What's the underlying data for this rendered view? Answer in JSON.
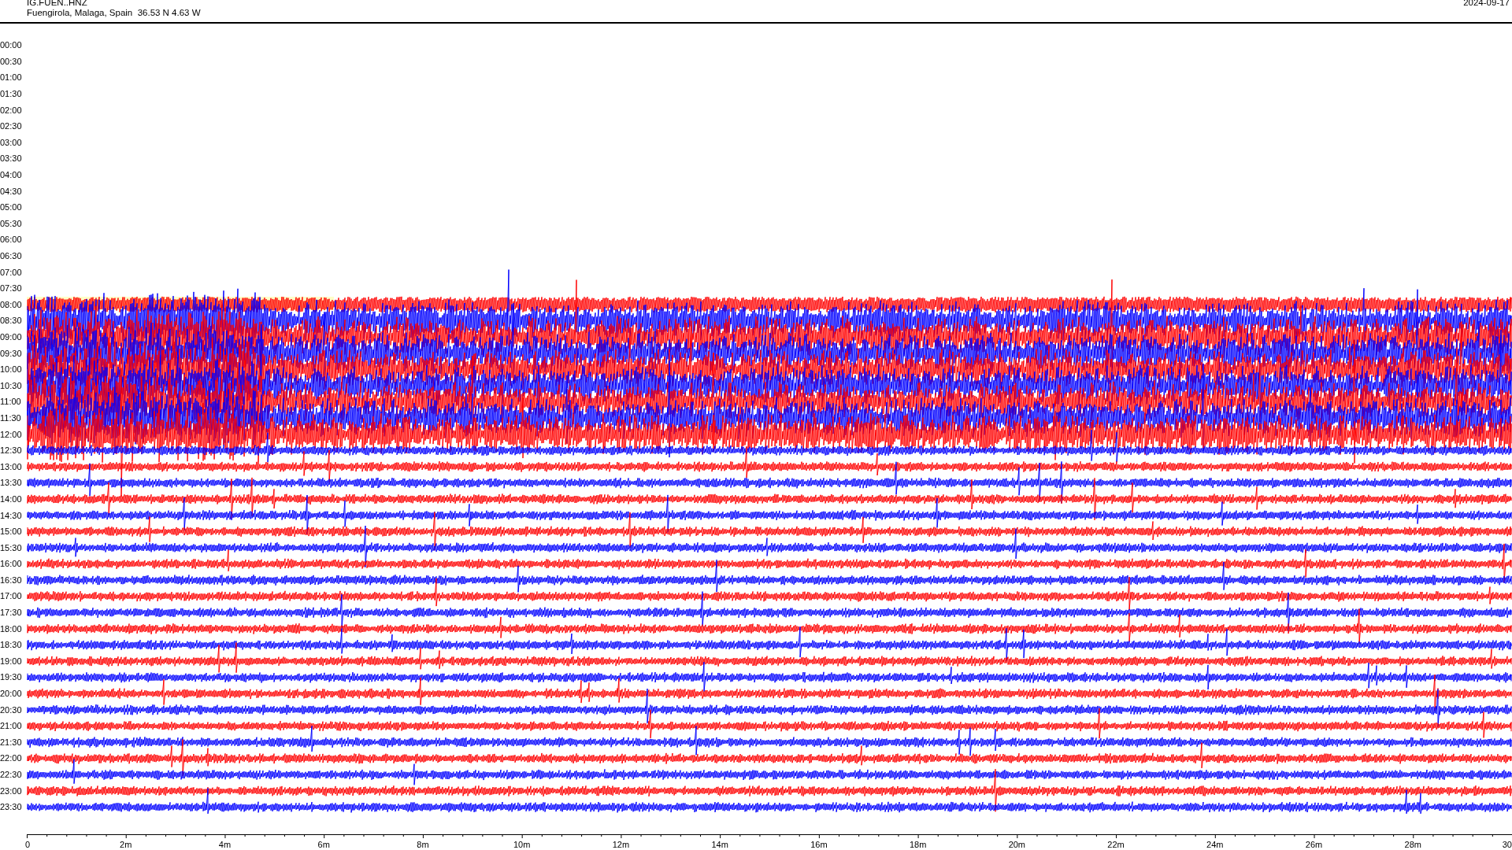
{
  "header": {
    "station": "IG.FUEN..HNZ",
    "location": "Fuengirola, Malaga, Spain  36.53 N 4.63 W",
    "date": "2024-09-17"
  },
  "rows": [
    {
      "time": "00:00",
      "trace": false
    },
    {
      "time": "00:30",
      "trace": false
    },
    {
      "time": "01:00",
      "trace": false
    },
    {
      "time": "01:30",
      "trace": false
    },
    {
      "time": "02:00",
      "trace": false
    },
    {
      "time": "02:30",
      "trace": false
    },
    {
      "time": "03:00",
      "trace": false
    },
    {
      "time": "03:30",
      "trace": false
    },
    {
      "time": "04:00",
      "trace": false
    },
    {
      "time": "04:30",
      "trace": false
    },
    {
      "time": "05:00",
      "trace": false
    },
    {
      "time": "05:30",
      "trace": false
    },
    {
      "time": "06:00",
      "trace": false
    },
    {
      "time": "06:30",
      "trace": false
    },
    {
      "time": "07:00",
      "trace": false
    },
    {
      "time": "07:30",
      "trace": false
    },
    {
      "time": "08:00",
      "trace": true
    },
    {
      "time": "08:30",
      "trace": true
    },
    {
      "time": "09:00",
      "trace": true
    },
    {
      "time": "09:30",
      "trace": true
    },
    {
      "time": "10:00",
      "trace": true
    },
    {
      "time": "10:30",
      "trace": true
    },
    {
      "time": "11:00",
      "trace": true
    },
    {
      "time": "11:30",
      "trace": true
    },
    {
      "time": "12:00",
      "trace": true
    },
    {
      "time": "12:30",
      "trace": true
    },
    {
      "time": "13:00",
      "trace": true
    },
    {
      "time": "13:30",
      "trace": true
    },
    {
      "time": "14:00",
      "trace": true
    },
    {
      "time": "14:30",
      "trace": true
    },
    {
      "time": "15:00",
      "trace": true
    },
    {
      "time": "15:30",
      "trace": true
    },
    {
      "time": "16:00",
      "trace": true
    },
    {
      "time": "16:30",
      "trace": true
    },
    {
      "time": "17:00",
      "trace": true
    },
    {
      "time": "17:30",
      "trace": true
    },
    {
      "time": "18:00",
      "trace": true
    },
    {
      "time": "18:30",
      "trace": true
    },
    {
      "time": "19:00",
      "trace": true
    },
    {
      "time": "19:30",
      "trace": true
    },
    {
      "time": "20:00",
      "trace": true
    },
    {
      "time": "20:30",
      "trace": true
    },
    {
      "time": "21:00",
      "trace": true
    },
    {
      "time": "21:30",
      "trace": true
    },
    {
      "time": "22:00",
      "trace": true
    },
    {
      "time": "22:30",
      "trace": true
    },
    {
      "time": "23:00",
      "trace": true
    },
    {
      "time": "23:30",
      "trace": true
    }
  ],
  "x_axis": {
    "ticks": [
      "0",
      "2m",
      "4m",
      "6m",
      "8m",
      "10m",
      "12m",
      "14m",
      "16m",
      "18m",
      "20m",
      "22m",
      "24m",
      "26m",
      "28m",
      "30"
    ]
  }
}
